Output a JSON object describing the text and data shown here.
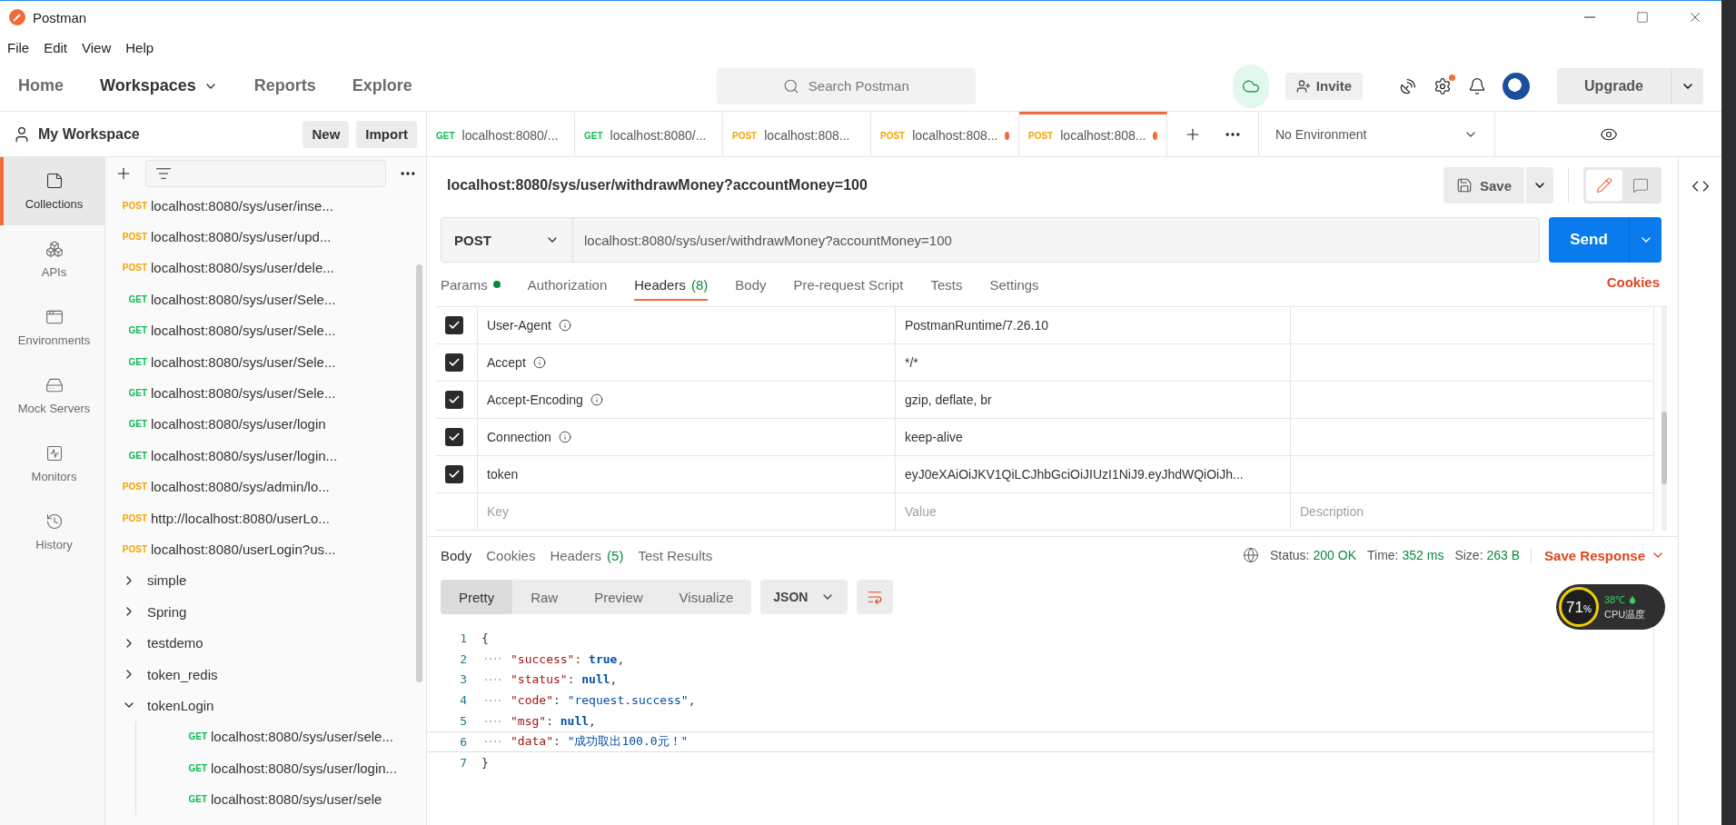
{
  "window": {
    "title": "Postman"
  },
  "menu": [
    "File",
    "Edit",
    "View",
    "Help"
  ],
  "nav": [
    {
      "label": "Home",
      "selected": false,
      "dropdown": false
    },
    {
      "label": "Workspaces",
      "selected": true,
      "dropdown": true
    },
    {
      "label": "Reports",
      "selected": false,
      "dropdown": false
    },
    {
      "label": "Explore",
      "selected": false,
      "dropdown": false
    }
  ],
  "search": {
    "placeholder": "Search Postman"
  },
  "invite": "Invite",
  "upgrade": "Upgrade",
  "settings_notice": true,
  "workspace": {
    "name": "My Workspace",
    "buttons": [
      "New",
      "Import"
    ]
  },
  "rail": [
    {
      "label": "Collections",
      "selected": true
    },
    {
      "label": "APIs",
      "selected": false
    },
    {
      "label": "Environments",
      "selected": false
    },
    {
      "label": "Mock Servers",
      "selected": false
    },
    {
      "label": "Monitors",
      "selected": false
    },
    {
      "label": "History",
      "selected": false
    }
  ],
  "tree": [
    {
      "kind": "request",
      "method": "POST",
      "url": "localhost:8080/sys/user/inse..."
    },
    {
      "kind": "request",
      "method": "POST",
      "url": "localhost:8080/sys/user/upd..."
    },
    {
      "kind": "request",
      "method": "POST",
      "url": "localhost:8080/sys/user/dele..."
    },
    {
      "kind": "request",
      "method": "GET",
      "url": "localhost:8080/sys/user/Sele..."
    },
    {
      "kind": "request",
      "method": "GET",
      "url": "localhost:8080/sys/user/Sele..."
    },
    {
      "kind": "request",
      "method": "GET",
      "url": "localhost:8080/sys/user/Sele..."
    },
    {
      "kind": "request",
      "method": "GET",
      "url": "localhost:8080/sys/user/Sele..."
    },
    {
      "kind": "request",
      "method": "GET",
      "url": "localhost:8080/sys/user/login"
    },
    {
      "kind": "request",
      "method": "GET",
      "url": "localhost:8080/sys/user/login..."
    },
    {
      "kind": "request",
      "method": "POST",
      "url": "localhost:8080/sys/admin/lo..."
    },
    {
      "kind": "request",
      "method": "POST",
      "url": "http://localhost:8080/userLo..."
    },
    {
      "kind": "request",
      "method": "POST",
      "url": "localhost:8080/userLogin?us..."
    },
    {
      "kind": "folder",
      "name": "simple",
      "expanded": false
    },
    {
      "kind": "folder",
      "name": "Spring",
      "expanded": false
    },
    {
      "kind": "folder",
      "name": "testdemo",
      "expanded": false
    },
    {
      "kind": "folder",
      "name": "token_redis",
      "expanded": false
    },
    {
      "kind": "folder",
      "name": "tokenLogin",
      "expanded": true,
      "children": [
        {
          "kind": "request",
          "method": "GET",
          "url": "localhost:8080/sys/user/sele..."
        },
        {
          "kind": "request",
          "method": "GET",
          "url": "localhost:8080/sys/user/login..."
        },
        {
          "kind": "request",
          "method": "GET",
          "url": "localhost:8080/sys/user/sele"
        }
      ]
    }
  ],
  "tabs": [
    {
      "method": "GET",
      "url": "localhost:8080/...",
      "modified": false,
      "selected": false
    },
    {
      "method": "GET",
      "url": "localhost:8080/...",
      "modified": false,
      "selected": false
    },
    {
      "method": "POST",
      "url": "localhost:808...",
      "modified": false,
      "selected": false
    },
    {
      "method": "POST",
      "url": "localhost:808...",
      "modified": true,
      "selected": false
    },
    {
      "method": "POST",
      "url": "localhost:808...",
      "modified": true,
      "selected": true
    }
  ],
  "environment": "No Environment",
  "request": {
    "name": "localhost:8080/sys/user/withdrawMoney?accountMoney=100",
    "save": "Save",
    "method": "POST",
    "url": "localhost:8080/sys/user/withdrawMoney?accountMoney=100",
    "send": "Send"
  },
  "request_tabs": [
    {
      "label": "Params",
      "dot": true,
      "selected": false
    },
    {
      "label": "Authorization",
      "selected": false
    },
    {
      "label": "Headers",
      "count": "(8)",
      "selected": true
    },
    {
      "label": "Body",
      "selected": false
    },
    {
      "label": "Pre-request Script",
      "selected": false
    },
    {
      "label": "Tests",
      "selected": false
    },
    {
      "label": "Settings",
      "selected": false
    }
  ],
  "cookies": "Cookies",
  "headers": [
    {
      "checked": true,
      "key": "User-Agent",
      "info": true,
      "value": "PostmanRuntime/7.26.10"
    },
    {
      "checked": true,
      "key": "Accept",
      "info": true,
      "value": "*/*"
    },
    {
      "checked": true,
      "key": "Accept-Encoding",
      "info": true,
      "value": "gzip, deflate, br"
    },
    {
      "checked": true,
      "key": "Connection",
      "info": true,
      "value": "keep-alive"
    },
    {
      "checked": true,
      "key": "token",
      "info": false,
      "value": "eyJ0eXAiOiJKV1QiLCJhbGciOiJIUzI1NiJ9.eyJhdWQiOiJh..."
    }
  ],
  "new_header": {
    "key_placeholder": "Key",
    "value_placeholder": "Value",
    "description_placeholder": "Description"
  },
  "response_tabs": [
    {
      "label": "Body",
      "selected": true
    },
    {
      "label": "Cookies",
      "selected": false
    },
    {
      "label": "Headers",
      "count": "(5)",
      "selected": false
    },
    {
      "label": "Test Results",
      "selected": false
    }
  ],
  "status": [
    {
      "label": "Status:",
      "value": "200 OK"
    },
    {
      "label": "Time:",
      "value": "352 ms"
    },
    {
      "label": "Size:",
      "value": "263 B"
    }
  ],
  "save_response": "Save Response",
  "view_modes": [
    {
      "label": "Pretty",
      "selected": true
    },
    {
      "label": "Raw",
      "selected": false
    },
    {
      "label": "Preview",
      "selected": false
    },
    {
      "label": "Visualize",
      "selected": false
    }
  ],
  "format": "JSON",
  "code": [
    {
      "number": "1",
      "indent": false,
      "tokens": [
        {
          "kind": "punct",
          "text": "{"
        }
      ]
    },
    {
      "number": "2",
      "indent": true,
      "tokens": [
        {
          "kind": "key",
          "text": "\"success\""
        },
        {
          "kind": "punct",
          "text": ": "
        },
        {
          "kind": "literal",
          "text": "true"
        },
        {
          "kind": "punct",
          "text": ","
        }
      ]
    },
    {
      "number": "3",
      "indent": true,
      "tokens": [
        {
          "kind": "key",
          "text": "\"status\""
        },
        {
          "kind": "punct",
          "text": ": "
        },
        {
          "kind": "literal",
          "text": "null"
        },
        {
          "kind": "punct",
          "text": ","
        }
      ]
    },
    {
      "number": "4",
      "indent": true,
      "tokens": [
        {
          "kind": "key",
          "text": "\"code\""
        },
        {
          "kind": "punct",
          "text": ": "
        },
        {
          "kind": "string",
          "text": "\"request.success\""
        },
        {
          "kind": "punct",
          "text": ","
        }
      ]
    },
    {
      "number": "5",
      "indent": true,
      "tokens": [
        {
          "kind": "key",
          "text": "\"msg\""
        },
        {
          "kind": "punct",
          "text": ": "
        },
        {
          "kind": "literal",
          "text": "null"
        },
        {
          "kind": "punct",
          "text": ","
        }
      ]
    },
    {
      "number": "6",
      "indent": true,
      "tokens": [
        {
          "kind": "key",
          "text": "\"data\""
        },
        {
          "kind": "punct",
          "text": ": "
        },
        {
          "kind": "string",
          "text": "\"成功取出100.0元！\""
        }
      ]
    },
    {
      "number": "7",
      "indent": false,
      "tokens": [
        {
          "kind": "punct",
          "text": "}"
        }
      ]
    }
  ],
  "cpu_widget": {
    "percent": "71",
    "unit": "%",
    "temperature": "38℃",
    "label": "CPU温度"
  }
}
